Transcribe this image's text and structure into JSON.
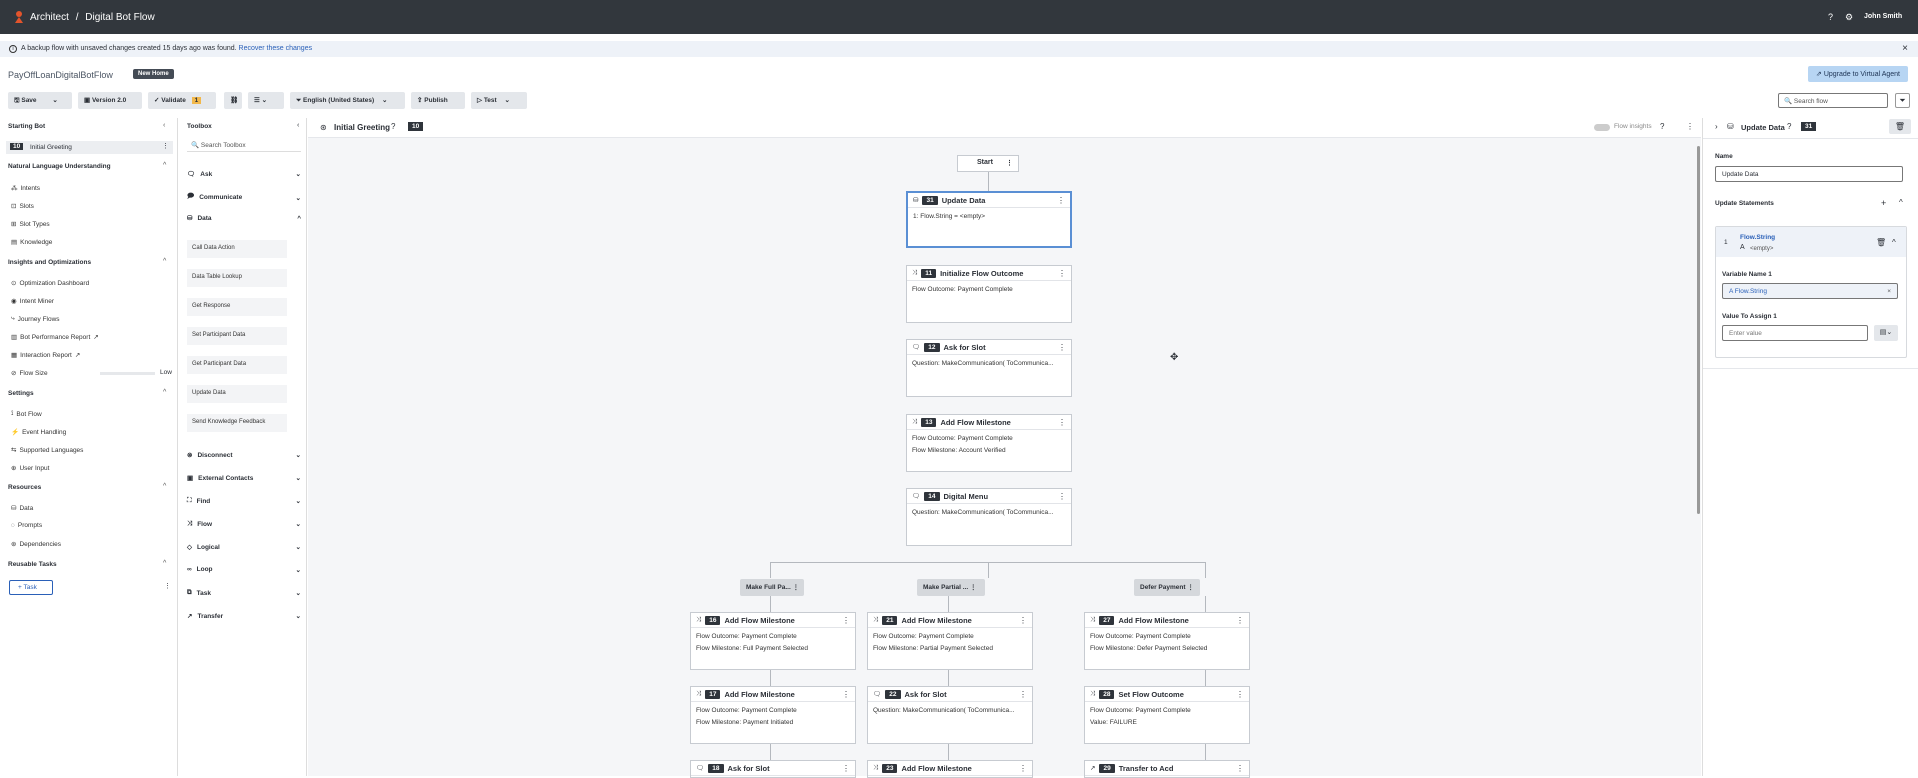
{
  "topbar": {
    "app": "Architect",
    "sep": "/",
    "page": "Digital Bot Flow",
    "user": "John Smith"
  },
  "banner": {
    "message": "A backup flow with unsaved changes created 15 days ago was found.",
    "link": "Recover these changes"
  },
  "header": {
    "flow_name": "PayOffLoanDigitalBotFlow",
    "badge": "New Home",
    "upgrade": "Upgrade to Virtual Agent"
  },
  "toolbar": {
    "save": "Save",
    "version": "Version 2.0",
    "validate": "Validate",
    "validate_count": "1",
    "language": "English (United States)",
    "publish": "Publish",
    "test": "Test",
    "search_placeholder": "Search flow"
  },
  "leftnav": {
    "starting_bot": "Starting Bot",
    "start_num": "10",
    "start_label": "Initial Greeting",
    "nlu": "Natural Language Understanding",
    "nlu_items": [
      "Intents",
      "Slots",
      "Slot Types",
      "Knowledge"
    ],
    "insights": "Insights and Optimizations",
    "insights_items": [
      "Optimization Dashboard",
      "Intent Miner",
      "Journey Flows",
      "Bot Performance Report",
      "Interaction Report"
    ],
    "flow_size": "Flow Size",
    "flow_size_val": "Low",
    "settings": "Settings",
    "settings_items": [
      "Bot Flow",
      "Event Handling",
      "Supported Languages",
      "User Input"
    ],
    "resources": "Resources",
    "resources_items": [
      "Data",
      "Prompts",
      "Dependencies"
    ],
    "reusable": "Reusable Tasks",
    "task_btn": "Task"
  },
  "toolbox": {
    "title": "Toolbox",
    "search": "Search Toolbox",
    "cats": [
      "Ask",
      "Communicate",
      "Data",
      "Disconnect",
      "External Contacts",
      "Find",
      "Flow",
      "Logical",
      "Loop",
      "Task",
      "Transfer"
    ],
    "data_items": [
      "Call Data Action",
      "Data Table Lookup",
      "Get Response",
      "Set Participant Data",
      "Get Participant Data",
      "Update Data",
      "Send Knowledge Feedback"
    ]
  },
  "canvas": {
    "title": "Initial Greeting",
    "num": "10",
    "flow_insights": "Flow insights",
    "start": "Start",
    "nodes": [
      {
        "num": "31",
        "title": "Update Data",
        "lines": [
          "1: Flow.String = <empty>"
        ]
      },
      {
        "num": "11",
        "title": "Initialize Flow Outcome",
        "lines": [
          "Flow Outcome: Payment Complete"
        ]
      },
      {
        "num": "12",
        "title": "Ask for Slot",
        "lines": [
          "Question: MakeCommunication( ToCommunica..."
        ]
      },
      {
        "num": "13",
        "title": "Add Flow Milestone",
        "lines": [
          "Flow Outcome: Payment Complete",
          "Flow Milestone: Account Verified"
        ]
      },
      {
        "num": "14",
        "title": "Digital Menu",
        "lines": [
          "Question: MakeCommunication( ToCommunica..."
        ]
      },
      {
        "num": "16",
        "title": "Add Flow Milestone",
        "lines": [
          "Flow Outcome: Payment Complete",
          "Flow Milestone: Full Payment Selected"
        ]
      },
      {
        "num": "21",
        "title": "Add Flow Milestone",
        "lines": [
          "Flow Outcome: Payment Complete",
          "Flow Milestone: Partial Payment Selected"
        ]
      },
      {
        "num": "27",
        "title": "Add Flow Milestone",
        "lines": [
          "Flow Outcome: Payment Complete",
          "Flow Milestone: Defer Payment Selected"
        ]
      },
      {
        "num": "17",
        "title": "Add Flow Milestone",
        "lines": [
          "Flow Outcome: Payment Complete",
          "Flow Milestone: Payment Initiated"
        ]
      },
      {
        "num": "22",
        "title": "Ask for Slot",
        "lines": [
          "Question: MakeCommunication( ToCommunica..."
        ]
      },
      {
        "num": "28",
        "title": "Set Flow Outcome",
        "lines": [
          "Flow Outcome: Payment Complete",
          "Value: FAILURE"
        ]
      },
      {
        "num": "18",
        "title": "Ask for Slot",
        "lines": []
      },
      {
        "num": "23",
        "title": "Add Flow Milestone",
        "lines": []
      },
      {
        "num": "29",
        "title": "Transfer to Acd",
        "lines": []
      }
    ],
    "paths": [
      "Make Full Pa...",
      "Make Partial ...",
      "Defer Payment"
    ]
  },
  "rightpanel": {
    "title": "Update Data",
    "num": "31",
    "name_label": "Name",
    "name_value": "Update Data",
    "statements": "Update Statements",
    "stmt_index": "1",
    "stmt_var": "Flow.String",
    "stmt_val": "<empty>",
    "var_label": "Variable Name 1",
    "var_value": "Flow.String",
    "assign_label": "Value To Assign 1",
    "assign_placeholder": "Enter value"
  }
}
